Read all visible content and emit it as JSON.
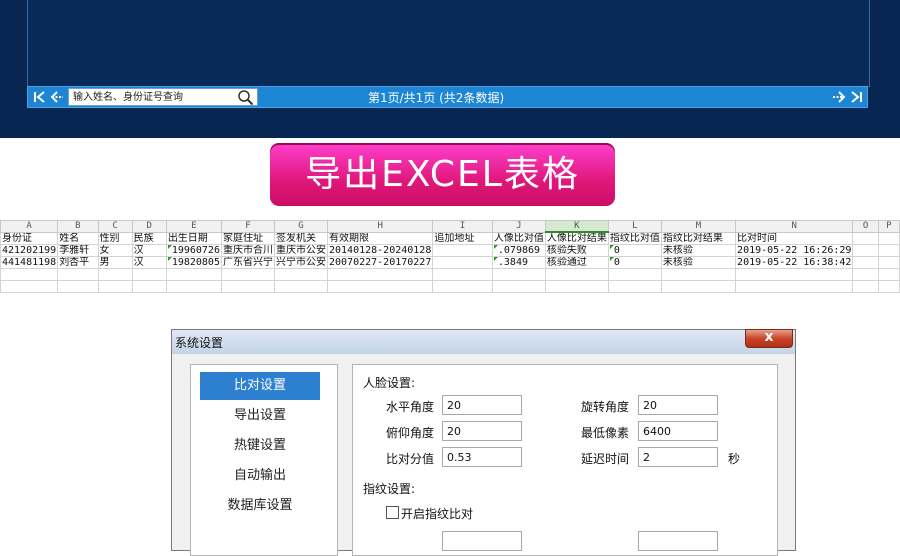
{
  "pager": {
    "search_placeholder": "输入姓名、身份证号查询",
    "page_info": "第1页/共1页 (共2条数据)"
  },
  "banner": {
    "text": "导出EXCEL表格"
  },
  "sheet": {
    "columns": [
      "A",
      "B",
      "C",
      "D",
      "E",
      "F",
      "G",
      "H",
      "I",
      "J",
      "K",
      "L",
      "M",
      "N",
      "O",
      "P"
    ],
    "header_row": [
      "身份证",
      "姓名",
      "性别",
      "民族",
      "出生日期",
      "家庭住址",
      "签发机关",
      "有效期限",
      "追加地址",
      "人像比对值",
      "人像比对结果",
      "指纹比对值",
      "指纹比对结果",
      "比对时间",
      "",
      ""
    ],
    "rows": [
      [
        "421202199",
        "李雅轩",
        "女",
        "汉",
        "19960726",
        "重庆市合川",
        "重庆市公安",
        "20140128-20240128",
        "",
        ".079869",
        "核验失败",
        "0",
        "未核验",
        "2019-05-22  16:26:29",
        "",
        ""
      ],
      [
        "441481198",
        "刘杏平",
        "男",
        "汉",
        "19820805",
        "广东省兴宁",
        "兴宁市公安",
        "20070227-20170227",
        "",
        ".3849",
        "核验通过",
        "0",
        "未核验",
        "2019-05-22  16:38:42",
        "",
        ""
      ]
    ]
  },
  "dialog": {
    "title": "系统设置",
    "close_glyph": "x",
    "nav": [
      "比对设置",
      "导出设置",
      "热键设置",
      "自动输出",
      "数据库设置"
    ],
    "face_section": "人脸设置:",
    "fields": {
      "horizontal_angle_label": "水平角度",
      "horizontal_angle": "20",
      "pitch_angle_label": "俯仰角度",
      "pitch_angle": "20",
      "threshold_label": "比对分值",
      "threshold": "0.53",
      "rotation_angle_label": "旋转角度",
      "rotation_angle": "20",
      "min_pixels_label": "最低像素",
      "min_pixels": "6400",
      "delay_label": "延迟时间",
      "delay": "2",
      "delay_unit": "秒"
    },
    "fingerprint_section": "指纹设置:",
    "fingerprint_checkbox_label": "开启指纹比对"
  },
  "colors": {
    "top_bg": "#072752",
    "pager_bg": "#1d86d4",
    "banner": "#e0187a",
    "nav_active": "#2d7fd0"
  }
}
